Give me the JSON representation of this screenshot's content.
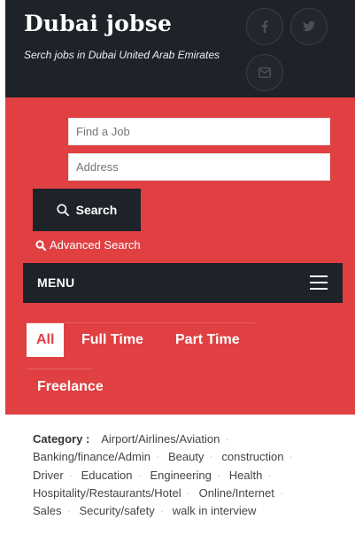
{
  "header": {
    "title": "Dubai jobse",
    "tagline": "Serch jobs in Dubai United Arab Emirates",
    "social_icons": [
      "facebook-icon",
      "twitter-icon",
      "envelope-icon"
    ]
  },
  "search": {
    "job_placeholder": "Find a Job",
    "address_placeholder": "Address",
    "button_label": "Search",
    "advanced_label": "Advanced Search"
  },
  "menu": {
    "label": "MENU"
  },
  "tabs": [
    {
      "label": "All",
      "active": true
    },
    {
      "label": "Full Time",
      "active": false
    },
    {
      "label": "Part Time",
      "active": false
    },
    {
      "label": "Freelance",
      "active": false
    }
  ],
  "categories": {
    "heading": "Category :",
    "items": [
      "Airport/Airlines/Aviation",
      "Banking/finance/Admin",
      "Beauty",
      "construction",
      "Driver",
      "Education",
      "Engineering",
      "Health",
      "Hospitality/Restaurants/Hotel",
      "Online/Internet",
      "Sales",
      "Security/safety",
      "walk in interview"
    ]
  },
  "colors": {
    "brand_red": "#e04042",
    "dark": "#1e2229"
  }
}
